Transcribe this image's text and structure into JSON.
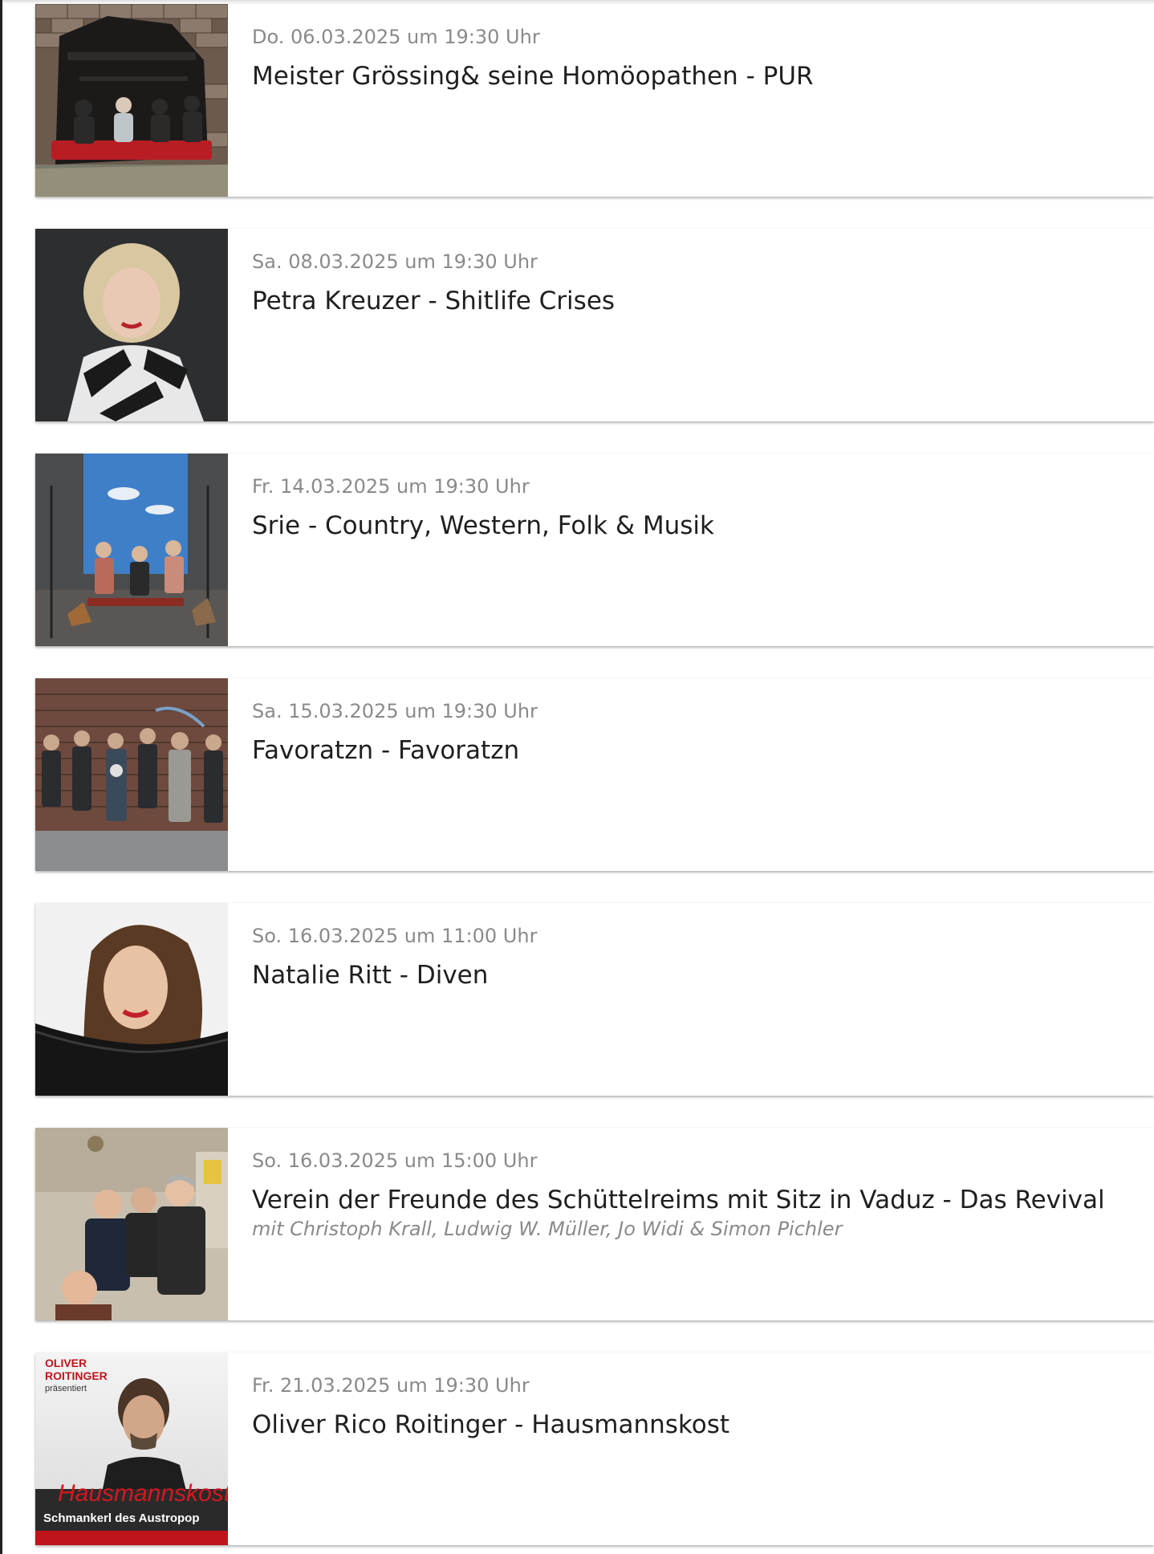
{
  "events": [
    {
      "date": "Do. 06.03.2025 um 19:30 Uhr",
      "title": "Meister Grössing& seine Homöopathen - PUR",
      "image": "band-broken-wall-photo"
    },
    {
      "date": "Sa. 08.03.2025 um 19:30 Uhr",
      "title": "Petra Kreuzer - Shitlife Crises",
      "image": "woman-portrait-photo"
    },
    {
      "date": "Fr. 14.03.2025 um 19:30 Uhr",
      "title": "Srie - Country, Western, Folk & Musik",
      "image": "trio-sky-backdrop-photo"
    },
    {
      "date": "Sa. 15.03.2025 um 19:30 Uhr",
      "title": "Favoratzn - Favoratzn",
      "image": "band-brick-wall-photo"
    },
    {
      "date": "So. 16.03.2025 um 11:00 Uhr",
      "title": "Natalie Ritt - Diven",
      "image": "singer-portrait-photo"
    },
    {
      "date": "So. 16.03.2025 um 15:00 Uhr",
      "title": "Verein der Freunde des Schüttelreims mit Sitz in Vaduz - Das Revival",
      "subtitle": "mit Christoph Krall, Ludwig W. Müller, Jo Widi & Simon Pichler",
      "image": "group-comedy-photo"
    },
    {
      "date": "Fr. 21.03.2025 um 19:30 Uhr",
      "title": "Oliver Rico Roitinger - Hausmannskost",
      "image": "hausmannskost-poster",
      "poster": {
        "line1": "OLIVER",
        "line2": "ROITINGER",
        "line3": "präsentiert",
        "script": "Hausmannskost",
        "banner": "Schmankerl des Austropop"
      }
    }
  ],
  "colors": {
    "date_text": "#8a8a8a",
    "title_text": "#1f1f1f",
    "poster_red": "#c0141c"
  }
}
